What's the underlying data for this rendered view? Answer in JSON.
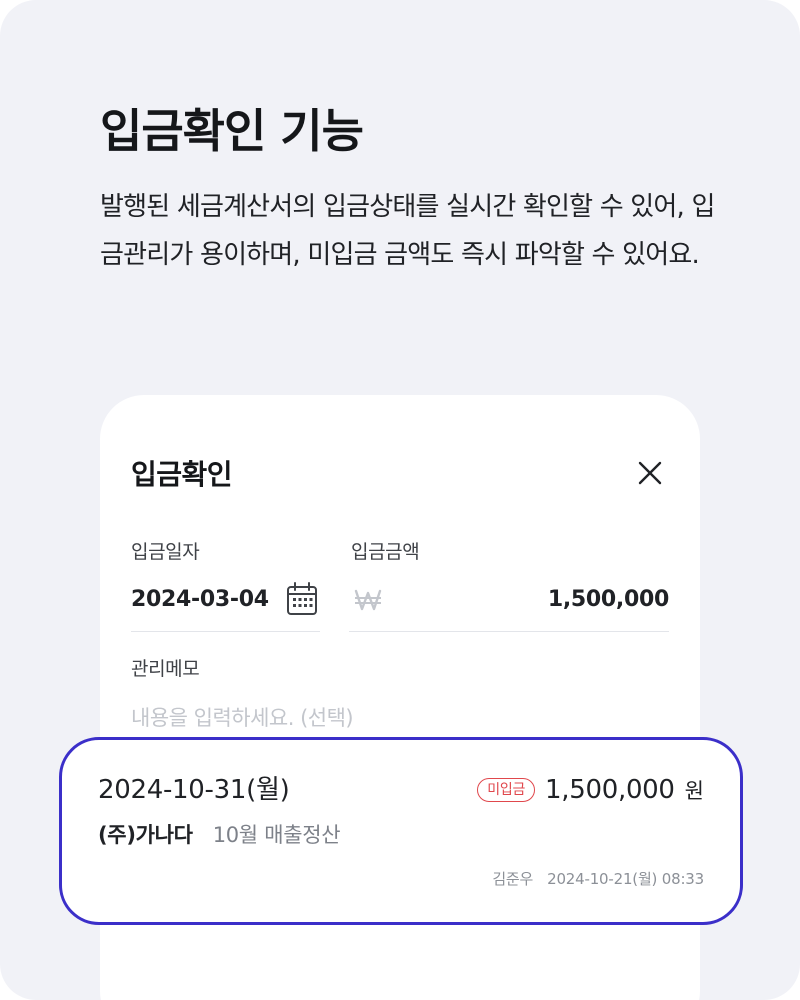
{
  "page": {
    "headline": "입금확인 기능",
    "description": "발행된 세금계산서의 입금상태를 실시간 확인할 수 있어, 입금관리가 용이하며, 미입금 금액도 즉시 파악할 수 있어요."
  },
  "modal": {
    "title": "입금확인",
    "close_icon": "close-icon",
    "deposit_date": {
      "label": "입금일자",
      "value": "2024-03-04",
      "icon": "calendar-icon"
    },
    "deposit_amount": {
      "label": "입금금액",
      "currency_icon": "won-icon",
      "value": "1,500,000"
    },
    "memo": {
      "label": "관리메모",
      "placeholder": "내용을 입력하세요. (선택)",
      "value": ""
    }
  },
  "record": {
    "date": "2024-10-31(월)",
    "status_badge": "미입금",
    "amount": "1,500,000",
    "unit": "원",
    "company": "(주)가나다",
    "description": "10월 매출정산",
    "author": "김준우",
    "timestamp": "2024-10-21(월) 08:33"
  },
  "colors": {
    "background": "#f1f2f7",
    "highlight_border": "#3b2fc9",
    "badge_red": "#e0474c",
    "placeholder": "#c3c6cc"
  }
}
